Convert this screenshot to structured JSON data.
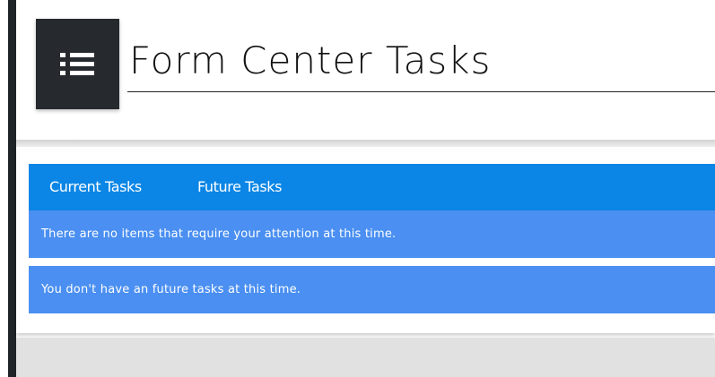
{
  "header": {
    "title": "Form Center Tasks",
    "menu_icon": "hamburger-list-icon"
  },
  "tabs": [
    {
      "label": "Current Tasks"
    },
    {
      "label": "Future Tasks"
    }
  ],
  "notices": {
    "current": "There are no items that require your attention at this time.",
    "future": "You don't have an future tasks at this time."
  },
  "colors": {
    "rail": "#1f2429",
    "menu_button": "#262a2f",
    "tab_strip": "#0b86e6",
    "notice_background": "#4a8ff1",
    "text_light": "#ffffff",
    "page_bottom": "#e1e1e1"
  }
}
